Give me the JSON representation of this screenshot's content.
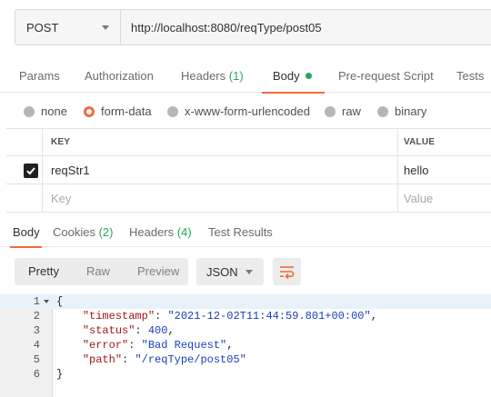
{
  "request": {
    "method": "POST",
    "url": "http://localhost:8080/reqType/post05"
  },
  "request_tabs": {
    "params": "Params",
    "authorization": "Authorization",
    "headers_label": "Headers",
    "headers_count": "(1)",
    "body": "Body",
    "prerequest": "Pre-request Script",
    "tests": "Tests"
  },
  "body_types": {
    "none": "none",
    "form_data": "form-data",
    "urlencoded": "x-www-form-urlencoded",
    "raw": "raw",
    "binary": "binary",
    "selected": "form-data"
  },
  "kv_table": {
    "key_header": "KEY",
    "value_header": "VALUE",
    "rows": [
      {
        "checked": true,
        "key": "reqStr1",
        "value": "hello"
      }
    ],
    "new_row": {
      "key_placeholder": "Key",
      "value_placeholder": "Value"
    }
  },
  "response_tabs": {
    "body": "Body",
    "cookies_label": "Cookies",
    "cookies_count": "(2)",
    "headers_label": "Headers",
    "headers_count": "(4)",
    "test_results": "Test Results"
  },
  "response_toolbar": {
    "pretty": "Pretty",
    "raw": "Raw",
    "preview": "Preview",
    "format": "JSON"
  },
  "response_body": {
    "line_numbers": [
      "1",
      "2",
      "3",
      "4",
      "5",
      "6"
    ],
    "open_brace": "{",
    "close_brace": "}",
    "timestamp_key": "\"timestamp\"",
    "timestamp_val": "\"2021-12-02T11:44:59.801+00:00\"",
    "status_key": "\"status\"",
    "status_val": "400",
    "error_key": "\"error\"",
    "error_val": "\"Bad Request\"",
    "path_key": "\"path\"",
    "path_val": "\"/reqType/post05\""
  },
  "colors": {
    "accent": "#f26b3a",
    "count_green": "#26a65b"
  }
}
